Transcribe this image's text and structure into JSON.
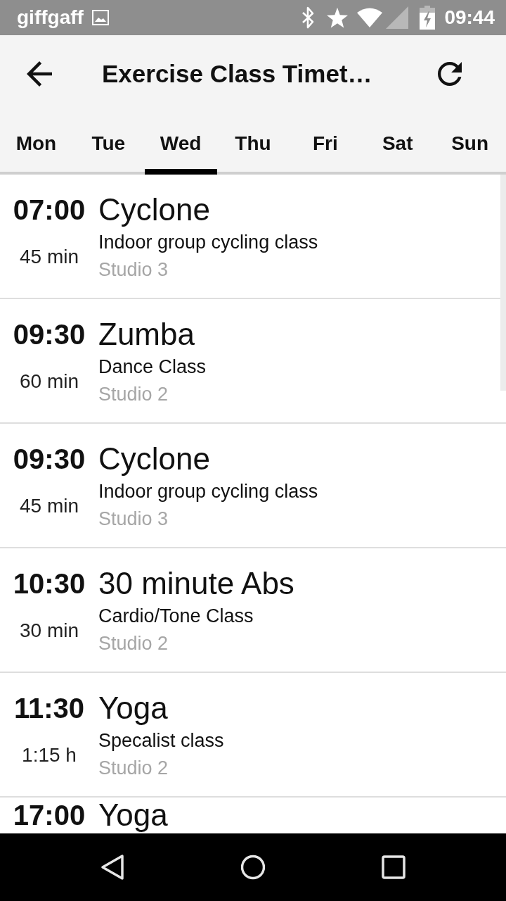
{
  "status_bar": {
    "carrier": "giffgaff",
    "time": "09:44"
  },
  "app_bar": {
    "title": "Exercise Class Timet…"
  },
  "tabs": [
    {
      "label": "Mon",
      "selected": false
    },
    {
      "label": "Tue",
      "selected": false
    },
    {
      "label": "Wed",
      "selected": true
    },
    {
      "label": "Thu",
      "selected": false
    },
    {
      "label": "Fri",
      "selected": false
    },
    {
      "label": "Sat",
      "selected": false
    },
    {
      "label": "Sun",
      "selected": false
    }
  ],
  "classes": [
    {
      "time": "07:00",
      "duration": "45 min",
      "name": "Cyclone",
      "description": "Indoor group cycling class",
      "location": "Studio 3"
    },
    {
      "time": "09:30",
      "duration": "60 min",
      "name": "Zumba",
      "description": "Dance Class",
      "location": "Studio 2"
    },
    {
      "time": "09:30",
      "duration": "45 min",
      "name": "Cyclone",
      "description": "Indoor group cycling class",
      "location": "Studio 3"
    },
    {
      "time": "10:30",
      "duration": "30 min",
      "name": "30 minute Abs",
      "description": "Cardio/Tone Class",
      "location": "Studio 2"
    },
    {
      "time": "11:30",
      "duration": "1:15 h",
      "name": "Yoga",
      "description": "Specalist class",
      "location": "Studio 2"
    },
    {
      "time": "17:00",
      "name": "Yoga"
    }
  ]
}
